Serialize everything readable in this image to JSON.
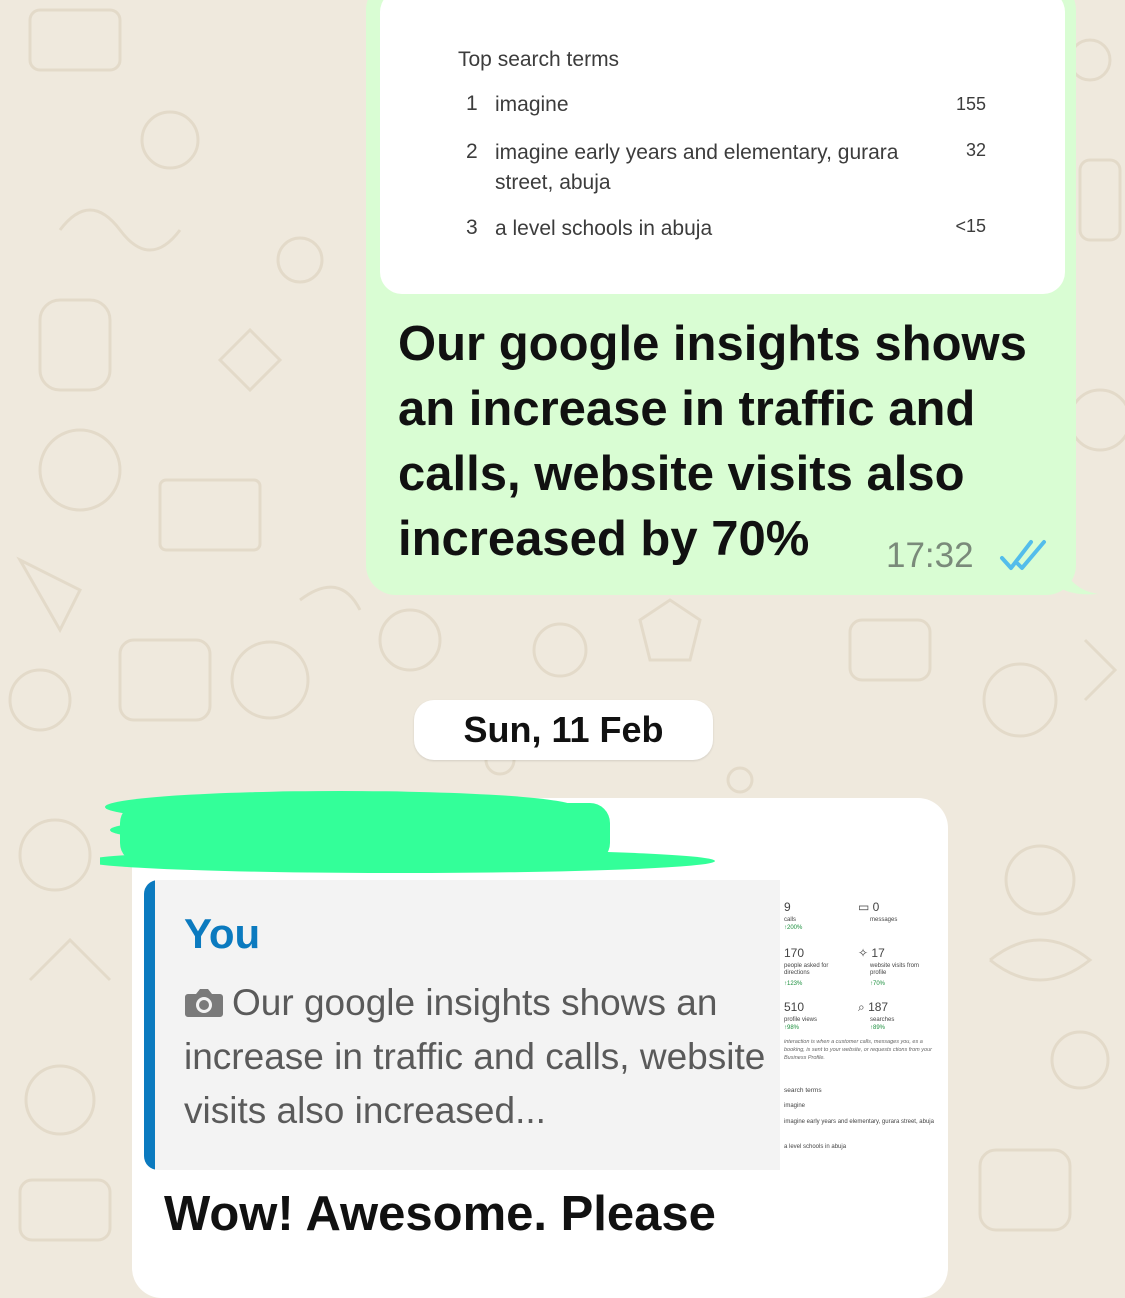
{
  "insight_card": {
    "title": "Top search terms",
    "terms": [
      {
        "rank": "1",
        "term": "imagine",
        "count": "155"
      },
      {
        "rank": "2",
        "term": "imagine early years and elementary, gurara street, abuja",
        "count": "32"
      },
      {
        "rank": "3",
        "term": "a level schools in abuja",
        "count": "<15"
      }
    ]
  },
  "outgoing_message": {
    "text": "Our google insights shows an increase in traffic and calls, website visits also increased by 70%",
    "time": "17:32",
    "status_icon": "double-check-read-icon",
    "tick_color": "#53bdeb"
  },
  "date_divider": {
    "label": "Sun, 11 Feb"
  },
  "incoming_message": {
    "quote": {
      "sender": "You",
      "media_icon": "camera-icon",
      "text": "Our google insights shows an increase in traffic and calls, website visits also increased..."
    },
    "thumbnail": {
      "stats": [
        {
          "value": "9",
          "label": "calls",
          "change": "↑200%"
        },
        {
          "value": "0",
          "label": "messages",
          "change": ""
        },
        {
          "value": "170",
          "label": "people asked for directions",
          "change": "↑123%"
        },
        {
          "value": "17",
          "label": "website visits from profile",
          "change": "↑70%"
        },
        {
          "value": "510",
          "label": "profile views",
          "change": "↑98%"
        },
        {
          "value": "187",
          "label": "searches",
          "change": "↑89%"
        }
      ],
      "note": "interaction is when a customer calls, messages you, es a booking, is sent to your website, or requests ctions from your Business Profile.",
      "terms_title": "search terms",
      "terms": [
        "imagine",
        "imagine early years and elementary, gurara street, abuja",
        "a level schools in abuja"
      ]
    },
    "reply_text": "Wow! Awesome. Please"
  },
  "colors": {
    "outgoing_bubble": "#d9fdd3",
    "incoming_bubble": "#ffffff",
    "quote_accent": "#0b7abf",
    "redaction": "#33ff99",
    "wallpaper": "#efe9dd"
  }
}
